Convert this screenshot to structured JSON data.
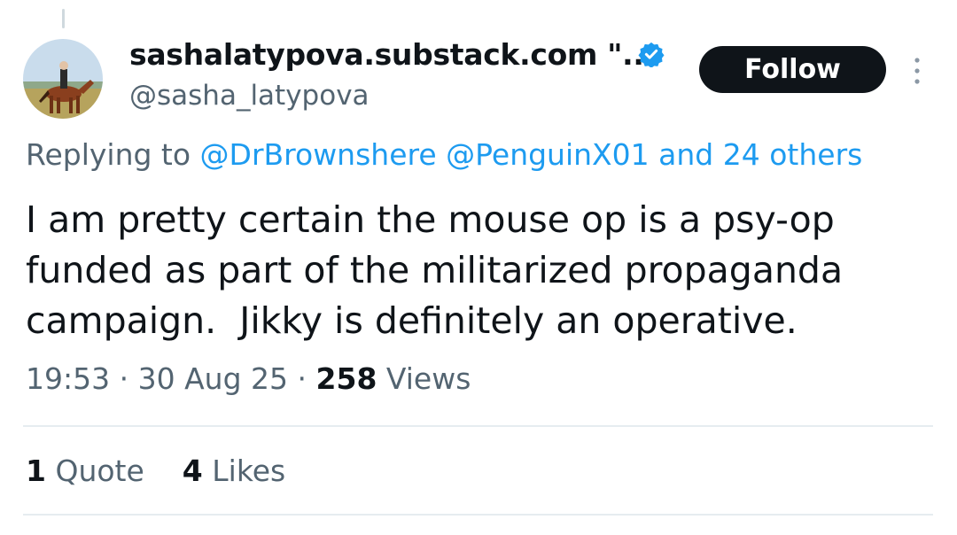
{
  "tweet": {
    "author": {
      "display_name": "sashalatypova.substack.com \"...",
      "handle": "@sasha_latypova",
      "verified": true,
      "avatar_icon": "avatar-rider-on-horse"
    },
    "follow_label": "Follow",
    "more_icon": "more-vertical-icon",
    "replying": {
      "prefix": "Replying to",
      "mention1": "@DrBrownshere",
      "mention2": "@PenguinX01",
      "others": "and 24 others"
    },
    "text": "I am pretty certain the mouse op is a psy-op\nfunded as part of the militarized propaganda\ncampaign.  Jikky is definitely an operative.",
    "time": "19:53",
    "date": "30 Aug 25",
    "views_count": "258",
    "views_label": "Views",
    "quotes_count": "1",
    "quotes_label": "Quote",
    "likes_count": "4",
    "likes_label": "Likes"
  },
  "colors": {
    "text_primary": "#0f1419",
    "text_secondary": "#536471",
    "link": "#1d9bf0",
    "verified_badge": "#1d9bf0",
    "divider": "#e6ecf0"
  }
}
